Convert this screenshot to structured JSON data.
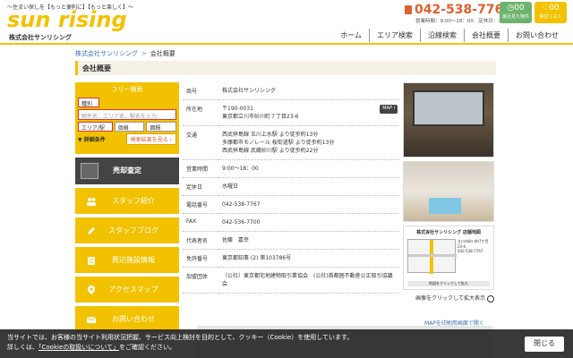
{
  "header": {
    "tagline": "〜住まい探しを【もっと便利に】【もっと楽しく】〜",
    "logo": "sun rising",
    "company": "株式会社サンリシング",
    "phone": "042-538-7767",
    "hours": "営業時間：9:00〜18：00　定休日：水曜日",
    "recent_count": "00",
    "recent_label": "最近見た物件",
    "fav_count": "00",
    "fav_label": "検討リスト"
  },
  "nav": [
    "ホーム",
    "エリア検索",
    "沿線検索",
    "会社概要",
    "お問い合わせ"
  ],
  "breadcrumb": {
    "home": "株式会社サンリシング",
    "sep": ">",
    "current": "会社概要"
  },
  "page_title": "会社概要",
  "search": {
    "title": "フリー検索",
    "type_select": "種別",
    "keyword_placeholder": "物件名、エリア名、駅名を入力",
    "area_select": "エリア/駅",
    "price_select": "価格",
    "size_select": "面積",
    "conditions_label": "▼ 詳細条件",
    "submit_label": "検索結果を見る ›"
  },
  "sidebar": {
    "banner": "売却査定",
    "items": [
      {
        "label": "スタッフ紹介",
        "icon": "people-icon"
      },
      {
        "label": "スタッフブログ",
        "icon": "pen-icon"
      },
      {
        "label": "周辺施設情報",
        "icon": "building-icon"
      },
      {
        "label": "アクセスマップ",
        "icon": "pin-icon"
      },
      {
        "label": "お問い合わせ",
        "icon": "mail-icon"
      }
    ]
  },
  "company_info": [
    {
      "label": "商号",
      "value": "株式会社サンリシング"
    },
    {
      "label": "所在地",
      "value": "〒190-0031\n東京都立川市砂川町７丁目23-6",
      "badge": "MAP ⅰ"
    },
    {
      "label": "交通",
      "value": "西武拝島線 玉川上水駅 より徒歩約13分\n多摩都市モノレール 桜街道駅 より徒歩約13分\n西武拝島線 武蔵砂川駅 より徒歩約22分"
    },
    {
      "label": "営業時間",
      "value": "9:00〜18：00"
    },
    {
      "label": "定休日",
      "value": "水曜日"
    },
    {
      "label": "電話番号",
      "value": "042-538-7767"
    },
    {
      "label": "FAX",
      "value": "042-536-7700"
    },
    {
      "label": "代表者名",
      "value": "佐藤　嘉幸"
    },
    {
      "label": "免許番号",
      "value": "東京都知事 (2) 第103786号"
    },
    {
      "label": "加盟団体",
      "value": "（公社）東京都宅地建物取引業協会　(公社)首都圏不動産公正取引協議会"
    }
  ],
  "photos": {
    "map_card_title": "株式会社サンリシング 店舗地図",
    "map_card_text": "立川市砂川町7丁目23-6\n042-538-7767",
    "map_card_footer": "地図をクリックして拡大",
    "enlarge_text": "画像をクリックして拡大表示"
  },
  "print_map": "MAPを印刷用画面で開く",
  "cookie": {
    "line1": "当サイトでは、お客様の当サイト利用状況把握、サービス向上検討を目的として、クッキー（Cookie）を使用しています。",
    "line2_prefix": "詳しくは、",
    "link": "「Cookieの取扱いについて」",
    "line2_suffix": "をご確認ください。",
    "close": "閉じる"
  }
}
